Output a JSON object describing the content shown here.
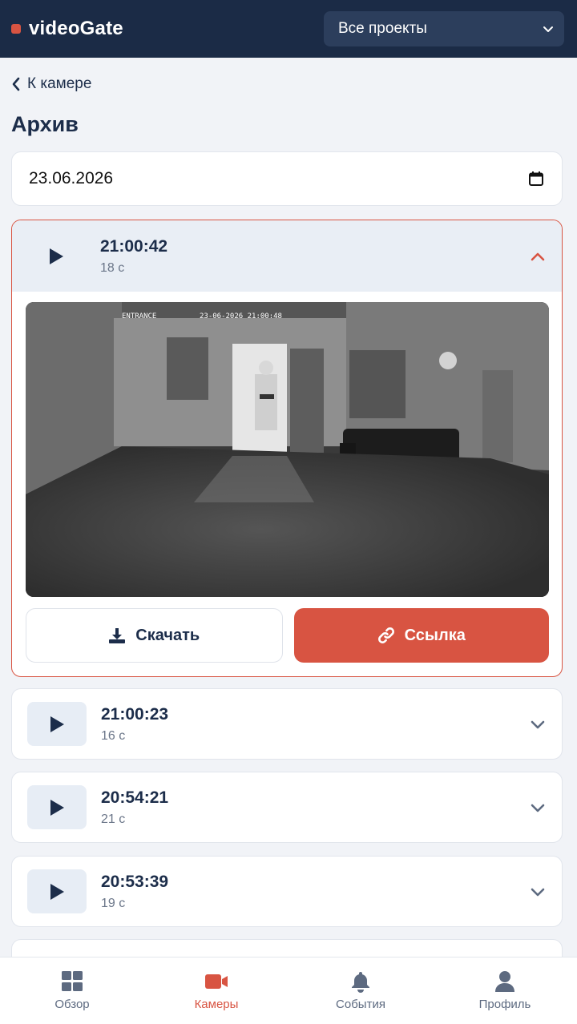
{
  "header": {
    "brand": "videoGate",
    "project_select": "Все проекты"
  },
  "back_label": "К камере",
  "page_title": "Архив",
  "date_value": "23.06.2026",
  "expanded_record": {
    "time": "21:00:42",
    "duration": "18 с",
    "overlay_label": "ENTRANCE",
    "overlay_timestamp": "23-06-2026 21:00:48",
    "download_label": "Скачать",
    "link_label": "Ссылка"
  },
  "records": [
    {
      "time": "21:00:23",
      "duration": "16 с"
    },
    {
      "time": "20:54:21",
      "duration": "21 с"
    },
    {
      "time": "20:53:39",
      "duration": "19 с"
    }
  ],
  "nav": [
    {
      "label": "Обзор",
      "icon": "grid-icon",
      "active": false
    },
    {
      "label": "Камеры",
      "icon": "video-camera-icon",
      "active": true
    },
    {
      "label": "События",
      "icon": "bell-icon",
      "active": false
    },
    {
      "label": "Профиль",
      "icon": "user-icon",
      "active": false
    }
  ],
  "colors": {
    "header_bg": "#1b2b46",
    "accent": "#d85442",
    "text_primary": "#1c2d4a",
    "page_bg": "#f1f3f7"
  }
}
